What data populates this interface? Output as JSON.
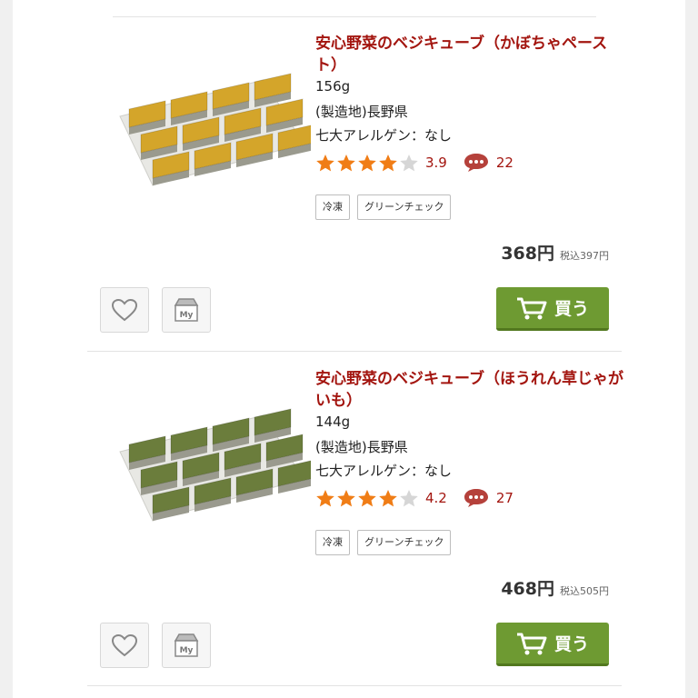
{
  "products": [
    {
      "title": "安心野菜のベジキューブ（かぼちゃペースト）",
      "weight": "156g",
      "origin": "(製造地)長野県",
      "allergen": "七大アレルゲン：なし",
      "rating": 3.9,
      "rating_text": "3.9",
      "reviews": "22",
      "tags": [
        "冷凍",
        "グリーンチェック"
      ],
      "price": "368円",
      "tax_price": "税込397円",
      "buy_label": "買う",
      "cube_color": "#d4a52a"
    },
    {
      "title": "安心野菜のベジキューブ（ほうれん草じゃがいも）",
      "weight": "144g",
      "origin": "(製造地)長野県",
      "allergen": "七大アレルゲン：なし",
      "rating": 4.2,
      "rating_text": "4.2",
      "reviews": "27",
      "tags": [
        "冷凍",
        "グリーンチェック"
      ],
      "price": "468円",
      "tax_price": "税込505円",
      "buy_label": "買う",
      "cube_color": "#6b7d3c"
    }
  ],
  "colors": {
    "title": "#a3150f",
    "star": "#f07d16",
    "buy_button": "#6e9a32"
  },
  "icons": [
    "heart-icon",
    "my-box-icon",
    "cart-icon",
    "comment-bubble-icon",
    "star-icon"
  ],
  "my_box_label": "My"
}
